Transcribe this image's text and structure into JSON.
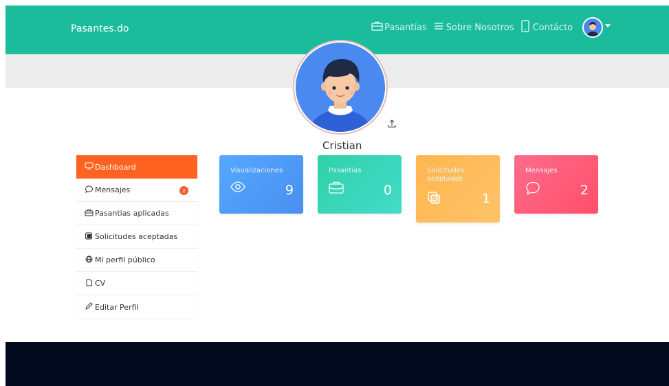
{
  "header": {
    "brand": "Pasantes.do",
    "nav": [
      {
        "label": "Pasantías",
        "icon": "briefcase-icon"
      },
      {
        "label": "Sobre Nosotros",
        "icon": "menu-icon"
      },
      {
        "label": "Contácto",
        "icon": "phone-icon"
      }
    ]
  },
  "profile": {
    "name": "Cristian"
  },
  "sidebar": {
    "items": [
      {
        "label": "Dashboard",
        "icon": "monitor-icon"
      },
      {
        "label": "Mensajes",
        "icon": "chat-icon",
        "badge": "2"
      },
      {
        "label": "Pasantias aplicadas",
        "icon": "briefcase-icon"
      },
      {
        "label": "Solicitudes aceptadas",
        "icon": "copy-icon"
      },
      {
        "label": "Mi perfil público",
        "icon": "globe-icon"
      },
      {
        "label": "CV",
        "icon": "file-icon"
      },
      {
        "label": "Editar Perfil",
        "icon": "pencil-icon"
      }
    ]
  },
  "cards": [
    {
      "title": "Visualizaciones",
      "value": "9",
      "icon": "eye-icon"
    },
    {
      "title": "Pasantias",
      "value": "0",
      "icon": "briefcase-icon"
    },
    {
      "title": "Solicitudes aceptadas",
      "value": "1",
      "icon": "copy-icon"
    },
    {
      "title": "Mensajes",
      "value": "2",
      "icon": "chat-icon"
    }
  ],
  "colors": {
    "header": "#1abc9c",
    "sidebar_active": "#ff6322",
    "footer": "#020a1e",
    "card_visualizaciones": "#4a9cf5",
    "card_pasantias": "#2fd5b5",
    "card_solicitudes": "#ffbb5c",
    "card_mensajes": "#ff5a78"
  }
}
